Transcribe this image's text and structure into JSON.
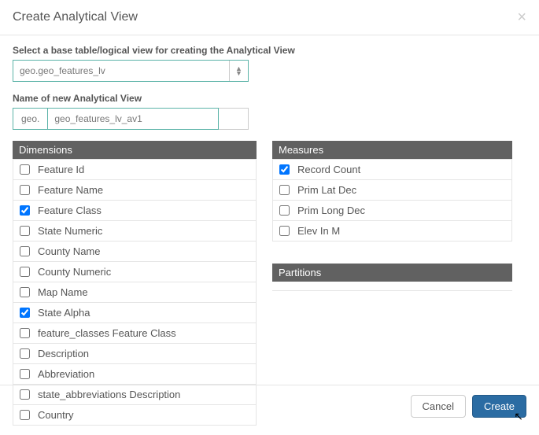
{
  "header": {
    "title": "Create Analytical View",
    "close": "×"
  },
  "base": {
    "label": "Select a base table/logical view for creating the Analytical View",
    "value": "geo.geo_features_lv"
  },
  "name": {
    "label": "Name of new Analytical View",
    "prefix": "geo.",
    "value": "geo_features_lv_av1"
  },
  "dimensions": {
    "title": "Dimensions",
    "items": [
      {
        "label": "Feature Id",
        "checked": false
      },
      {
        "label": "Feature Name",
        "checked": false
      },
      {
        "label": "Feature Class",
        "checked": true
      },
      {
        "label": "State Numeric",
        "checked": false
      },
      {
        "label": "County Name",
        "checked": false
      },
      {
        "label": "County Numeric",
        "checked": false
      },
      {
        "label": "Map Name",
        "checked": false
      },
      {
        "label": "State Alpha",
        "checked": true
      },
      {
        "label": "feature_classes Feature Class",
        "checked": false
      },
      {
        "label": "Description",
        "checked": false
      },
      {
        "label": "Abbreviation",
        "checked": false
      },
      {
        "label": "state_abbreviations Description",
        "checked": false
      },
      {
        "label": "Country",
        "checked": false
      }
    ]
  },
  "measures": {
    "title": "Measures",
    "items": [
      {
        "label": "Record Count",
        "checked": true
      },
      {
        "label": "Prim Lat Dec",
        "checked": false
      },
      {
        "label": "Prim Long Dec",
        "checked": false
      },
      {
        "label": "Elev In M",
        "checked": false
      }
    ]
  },
  "partitions": {
    "title": "Partitions"
  },
  "footer": {
    "cancel": "Cancel",
    "create": "Create"
  }
}
